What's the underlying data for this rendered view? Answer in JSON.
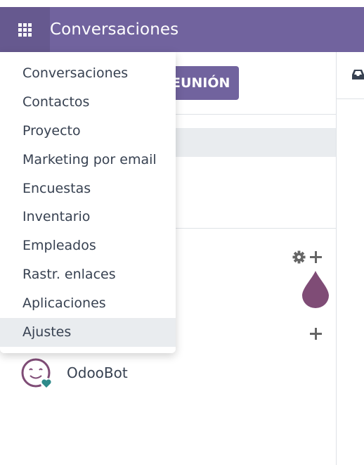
{
  "navbar": {
    "title": "Conversaciones",
    "apps_icon": "grid-icon"
  },
  "left": {
    "meeting_button": "EUNIÓN",
    "bot_name": "OdooBot"
  },
  "dropdown": {
    "items": [
      {
        "label": "Conversaciones"
      },
      {
        "label": "Contactos"
      },
      {
        "label": "Proyecto"
      },
      {
        "label": "Marketing por email"
      },
      {
        "label": "Encuestas"
      },
      {
        "label": "Inventario"
      },
      {
        "label": "Empleados"
      },
      {
        "label": "Rastr. enlaces"
      },
      {
        "label": "Aplicaciones"
      },
      {
        "label": "Ajustes"
      }
    ],
    "highlighted": "Ajustes"
  },
  "colors": {
    "brand": "#71639e",
    "avatar": "#7f4c76",
    "avatar_heart": "#2e8a8a"
  },
  "icons": [
    "grid-icon",
    "inbox-icon",
    "gear-icon",
    "plus-icon",
    "drop-icon",
    "odoobot-avatar"
  ]
}
